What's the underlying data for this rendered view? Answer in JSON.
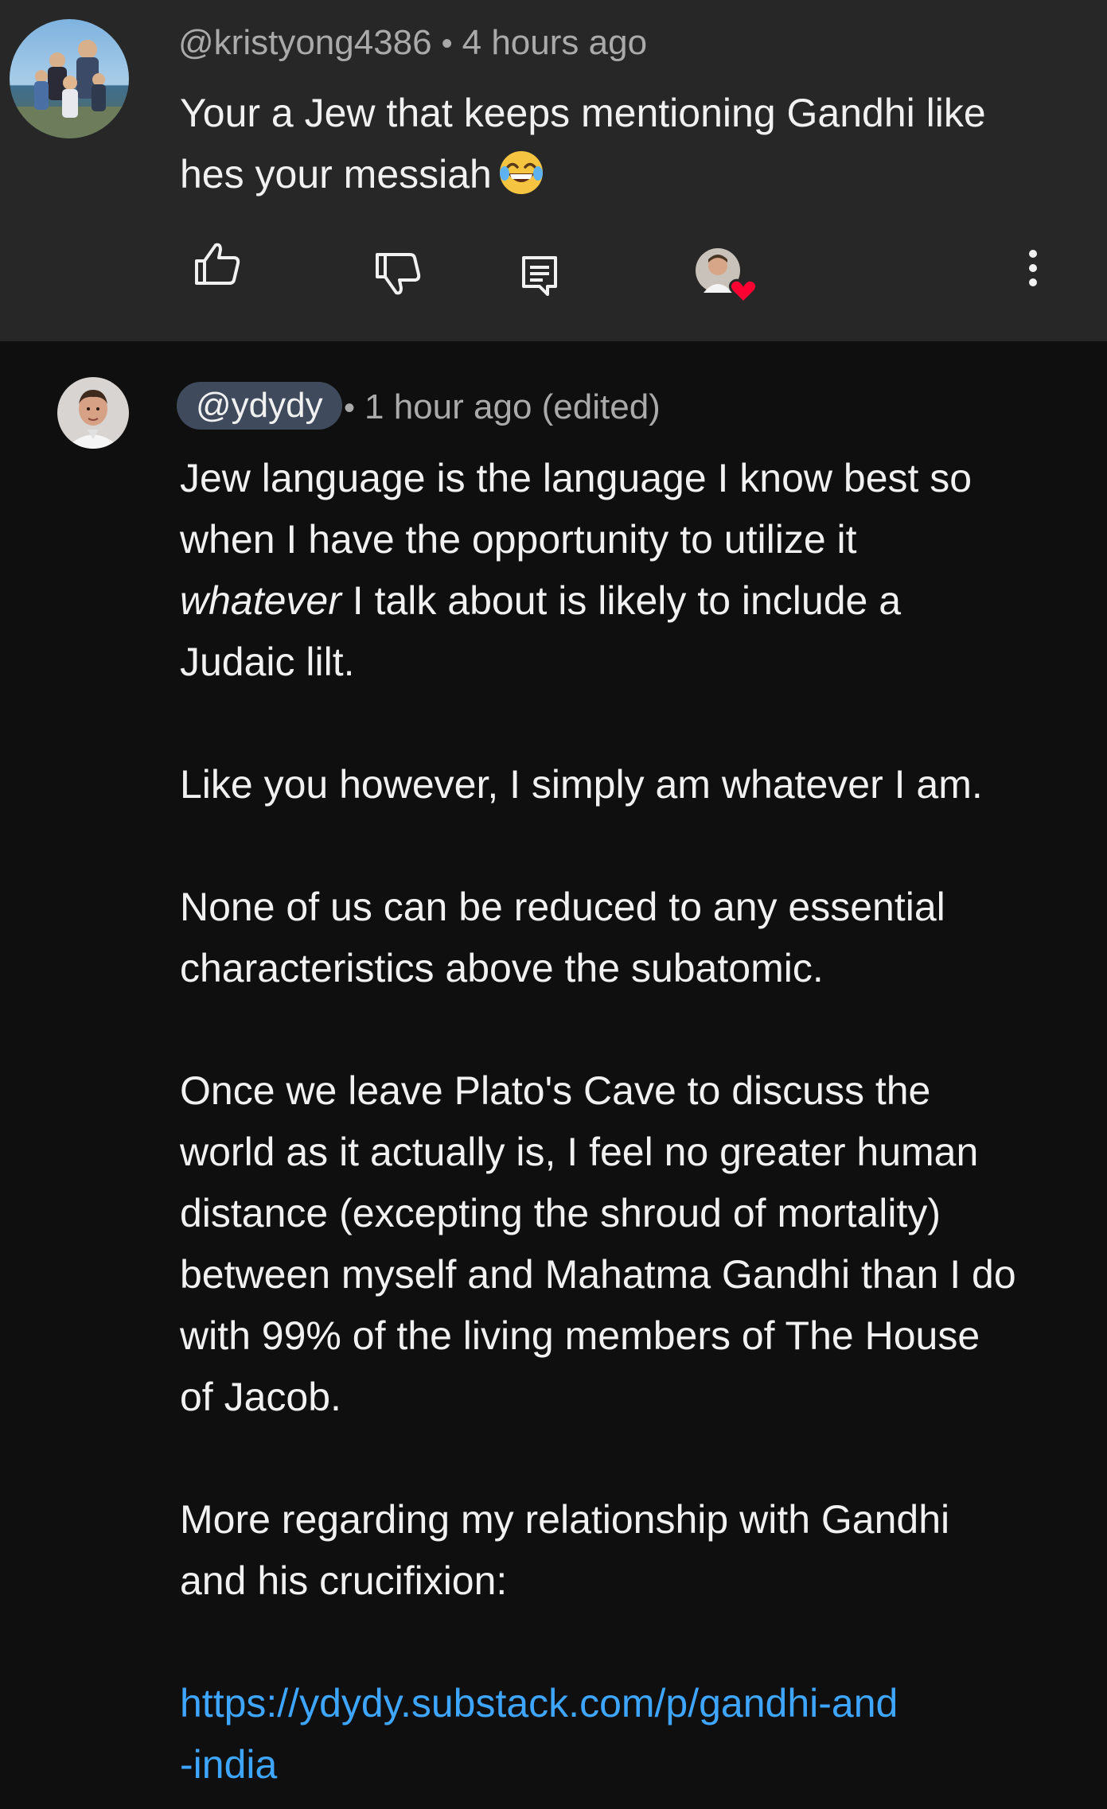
{
  "top_comment": {
    "handle": "@kristyong4386",
    "timestamp": "4 hours ago",
    "separator": "•",
    "text_line1": "Your a Jew that keeps mentioning Gandhi like",
    "text_line2": "hes your messiah",
    "emoji": "face-with-tears-of-joy",
    "actions": {
      "like_icon": "thumbs-up-icon",
      "dislike_icon": "thumbs-down-icon",
      "reply_icon": "reply-icon",
      "creator_heart": "creator-heart-badge",
      "more_icon": "more-vert-icon"
    }
  },
  "reply": {
    "handle": "@ydydy",
    "separator": "•",
    "timestamp": "1 hour ago (edited)",
    "p1_lines": [
      "Jew language is the language I know best so",
      "when I have the opportunity to utilize it"
    ],
    "p1_italic_word": "whatever",
    "p1_line3_rest": " I talk about is likely to include a",
    "p1_line4": "Judaic lilt.",
    "p2": "Like you however, I simply am whatever I am.",
    "p3_lines": [
      "None of us can be reduced to any essential",
      "characteristics above the subatomic."
    ],
    "p4_lines": [
      "Once we leave Plato's Cave to discuss the",
      "world as it actually is, I feel no greater human",
      "distance (excepting the shroud of mortality)",
      "between myself and Mahatma Gandhi than I do",
      "with 99% of the living members of The House",
      "of Jacob."
    ],
    "p5_lines": [
      "More regarding my relationship with Gandhi",
      "and his crucifixion:"
    ],
    "link_line1": "https://ydydy.substack.com/p/gandhi-and",
    "link_line2": "-india"
  },
  "colors": {
    "top_background": "#272727",
    "page_background": "#0f0f0f",
    "link": "#3ea6ff",
    "meta_text": "#aaaaaa",
    "chip_background": "#3f4b5c",
    "heart": "#ff0033"
  }
}
